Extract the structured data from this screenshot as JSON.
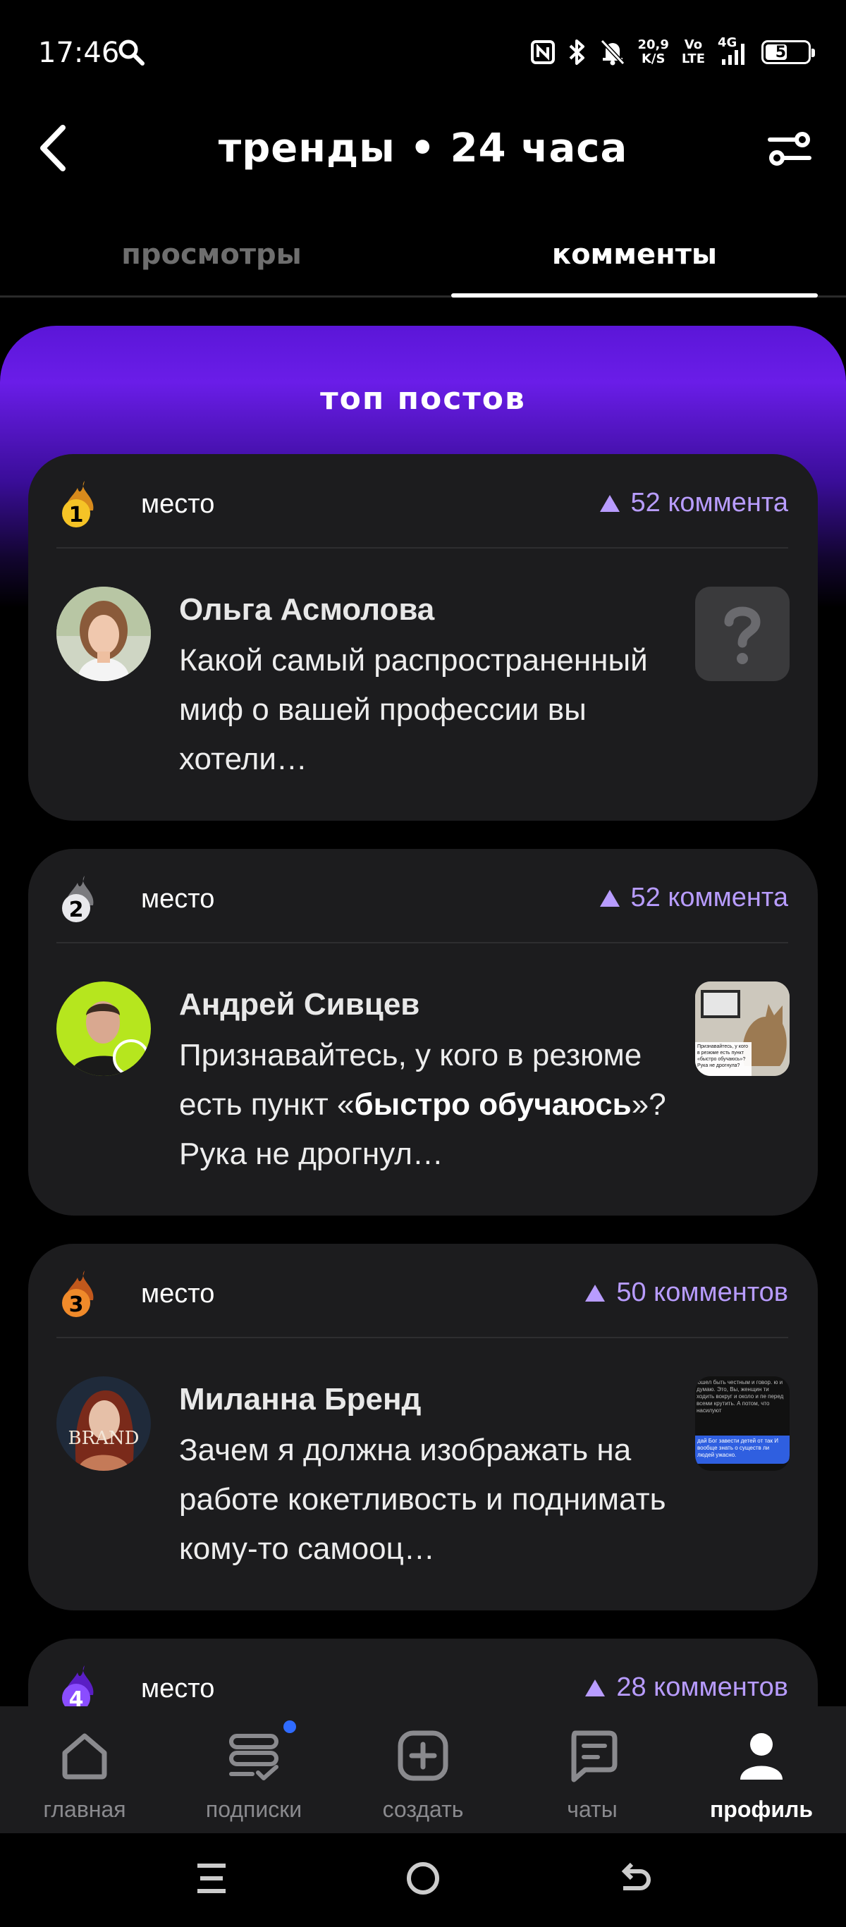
{
  "status_bar": {
    "time": "17:46",
    "net_speed": "20,9",
    "net_unit": "K/S",
    "volte_top": "Vo",
    "volte_bottom": "LTE",
    "network": "4G",
    "battery": "56",
    "battery_level": 0.56
  },
  "header": {
    "title": "тренды • 24 часа"
  },
  "tabs": [
    {
      "label": "просмотры",
      "active": false
    },
    {
      "label": "комменты",
      "active": true
    }
  ],
  "section": {
    "title": "топ постов"
  },
  "posts": [
    {
      "rank": "1",
      "rank_label": "место",
      "comments": "52 коммента",
      "author": "Ольга Асмолова",
      "text": "Какой самый распространенный миф о вашей профессии вы хотели…"
    },
    {
      "rank": "2",
      "rank_label": "место",
      "comments": "52 коммента",
      "author": "Андрей Сивцев",
      "text_parts": [
        "Признавайтесь, у кого в резюме есть пункт «",
        "быстро обучаюсь",
        "»? Рука не дрогнул…"
      ]
    },
    {
      "rank": "3",
      "rank_label": "место",
      "comments": "50 комментов",
      "author": "Миланна Бренд",
      "text": "Зачем я должна изображать на работе кокетливость и поднимать кому-то самооц…"
    },
    {
      "rank": "4",
      "rank_label": "место",
      "comments": "28 комментов"
    }
  ],
  "thumb_texts": {
    "andrey": "Признавайтесь, у кого в резюме есть пункт «быстро обучаюсь»? Рука не дрогнула?",
    "milanna": "юшел быть честным и говор. ю и думаю. Это, Вы, женщин ти ходить вокруг и около и пе перед всеми крутить. А потом, что насилуют",
    "milanna_bubble": "дай Бог завести детей от так И вообще знать о существ ли людей ужасно."
  },
  "avatar_texts": {
    "milanna": "BRAND"
  },
  "bottom_nav": [
    {
      "label": "главная",
      "icon": "home-icon"
    },
    {
      "label": "подписки",
      "icon": "subscriptions-icon",
      "badge": true
    },
    {
      "label": "создать",
      "icon": "create-icon"
    },
    {
      "label": "чаты",
      "icon": "chat-icon"
    },
    {
      "label": "профиль",
      "icon": "profile-icon",
      "active": true
    }
  ],
  "colors": {
    "accent": "#b89cff",
    "gradient_top": "#6a1de8",
    "card": "#1c1c1e",
    "badge_dot": "#2f6bff"
  }
}
